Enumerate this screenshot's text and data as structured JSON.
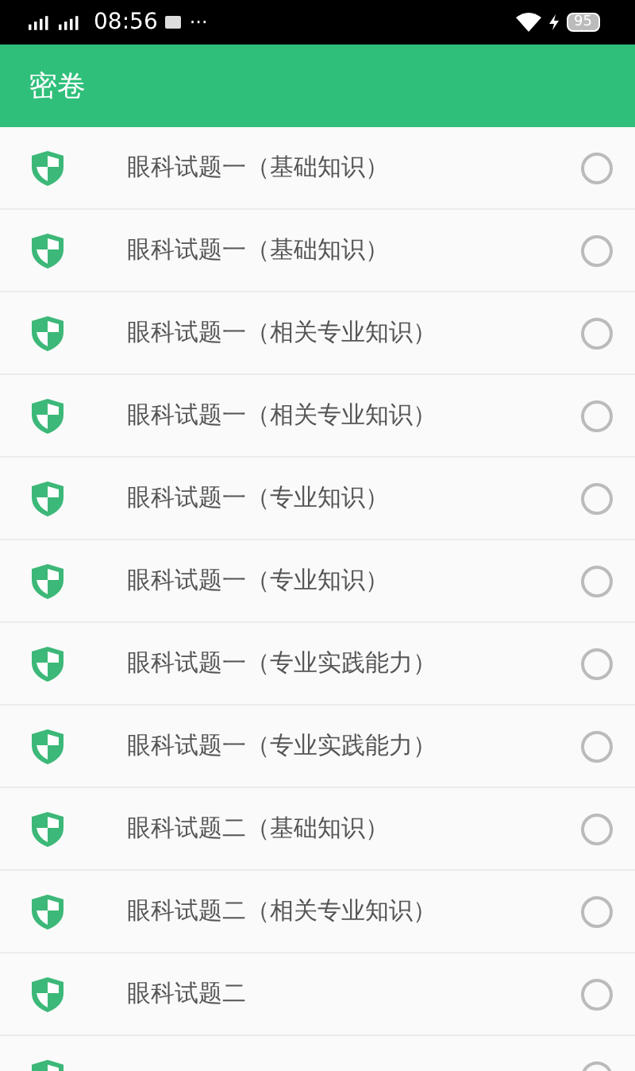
{
  "status_bar": {
    "time": "08:56",
    "more": "···",
    "battery": "95"
  },
  "header": {
    "title": "密卷"
  },
  "papers": [
    {
      "title": "眼科试题一（基础知识）",
      "checked": false
    },
    {
      "title": "眼科试题一（基础知识）",
      "checked": false
    },
    {
      "title": "眼科试题一（相关专业知识）",
      "checked": false
    },
    {
      "title": "眼科试题一（相关专业知识）",
      "checked": false
    },
    {
      "title": "眼科试题一（专业知识）",
      "checked": false
    },
    {
      "title": "眼科试题一（专业知识）",
      "checked": false
    },
    {
      "title": "眼科试题一（专业实践能力）",
      "checked": false
    },
    {
      "title": "眼科试题一（专业实践能力）",
      "checked": false
    },
    {
      "title": "眼科试题二（基础知识）",
      "checked": false
    },
    {
      "title": "眼科试题二（相关专业知识）",
      "checked": false
    },
    {
      "title": "眼科试题二",
      "checked": false
    },
    {
      "checked": false
    }
  ]
}
